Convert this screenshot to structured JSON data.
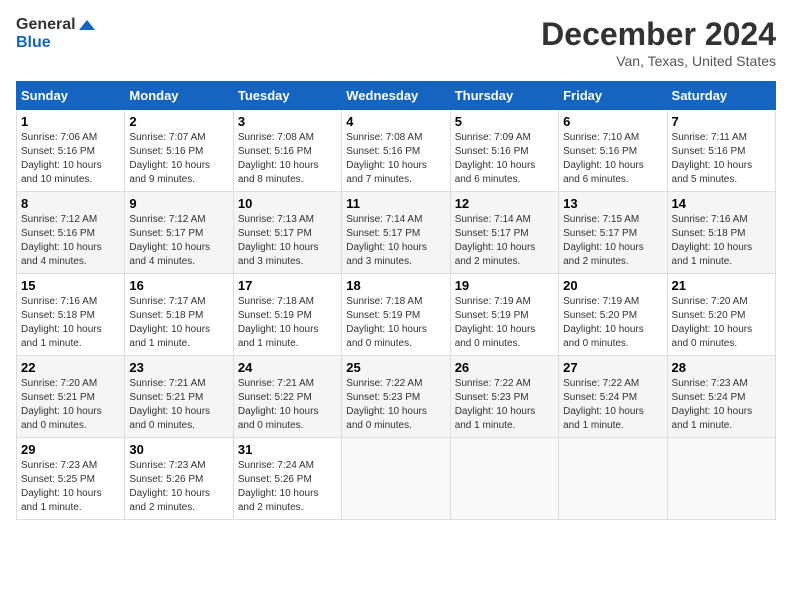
{
  "header": {
    "logo_line1": "General",
    "logo_line2": "Blue",
    "month_title": "December 2024",
    "location": "Van, Texas, United States"
  },
  "weekdays": [
    "Sunday",
    "Monday",
    "Tuesday",
    "Wednesday",
    "Thursday",
    "Friday",
    "Saturday"
  ],
  "weeks": [
    [
      {
        "day": "1",
        "sunrise": "7:06 AM",
        "sunset": "5:16 PM",
        "daylight": "10 hours and 10 minutes."
      },
      {
        "day": "2",
        "sunrise": "7:07 AM",
        "sunset": "5:16 PM",
        "daylight": "10 hours and 9 minutes."
      },
      {
        "day": "3",
        "sunrise": "7:08 AM",
        "sunset": "5:16 PM",
        "daylight": "10 hours and 8 minutes."
      },
      {
        "day": "4",
        "sunrise": "7:08 AM",
        "sunset": "5:16 PM",
        "daylight": "10 hours and 7 minutes."
      },
      {
        "day": "5",
        "sunrise": "7:09 AM",
        "sunset": "5:16 PM",
        "daylight": "10 hours and 6 minutes."
      },
      {
        "day": "6",
        "sunrise": "7:10 AM",
        "sunset": "5:16 PM",
        "daylight": "10 hours and 6 minutes."
      },
      {
        "day": "7",
        "sunrise": "7:11 AM",
        "sunset": "5:16 PM",
        "daylight": "10 hours and 5 minutes."
      }
    ],
    [
      {
        "day": "8",
        "sunrise": "7:12 AM",
        "sunset": "5:16 PM",
        "daylight": "10 hours and 4 minutes."
      },
      {
        "day": "9",
        "sunrise": "7:12 AM",
        "sunset": "5:17 PM",
        "daylight": "10 hours and 4 minutes."
      },
      {
        "day": "10",
        "sunrise": "7:13 AM",
        "sunset": "5:17 PM",
        "daylight": "10 hours and 3 minutes."
      },
      {
        "day": "11",
        "sunrise": "7:14 AM",
        "sunset": "5:17 PM",
        "daylight": "10 hours and 3 minutes."
      },
      {
        "day": "12",
        "sunrise": "7:14 AM",
        "sunset": "5:17 PM",
        "daylight": "10 hours and 2 minutes."
      },
      {
        "day": "13",
        "sunrise": "7:15 AM",
        "sunset": "5:17 PM",
        "daylight": "10 hours and 2 minutes."
      },
      {
        "day": "14",
        "sunrise": "7:16 AM",
        "sunset": "5:18 PM",
        "daylight": "10 hours and 1 minute."
      }
    ],
    [
      {
        "day": "15",
        "sunrise": "7:16 AM",
        "sunset": "5:18 PM",
        "daylight": "10 hours and 1 minute."
      },
      {
        "day": "16",
        "sunrise": "7:17 AM",
        "sunset": "5:18 PM",
        "daylight": "10 hours and 1 minute."
      },
      {
        "day": "17",
        "sunrise": "7:18 AM",
        "sunset": "5:19 PM",
        "daylight": "10 hours and 1 minute."
      },
      {
        "day": "18",
        "sunrise": "7:18 AM",
        "sunset": "5:19 PM",
        "daylight": "10 hours and 0 minutes."
      },
      {
        "day": "19",
        "sunrise": "7:19 AM",
        "sunset": "5:19 PM",
        "daylight": "10 hours and 0 minutes."
      },
      {
        "day": "20",
        "sunrise": "7:19 AM",
        "sunset": "5:20 PM",
        "daylight": "10 hours and 0 minutes."
      },
      {
        "day": "21",
        "sunrise": "7:20 AM",
        "sunset": "5:20 PM",
        "daylight": "10 hours and 0 minutes."
      }
    ],
    [
      {
        "day": "22",
        "sunrise": "7:20 AM",
        "sunset": "5:21 PM",
        "daylight": "10 hours and 0 minutes."
      },
      {
        "day": "23",
        "sunrise": "7:21 AM",
        "sunset": "5:21 PM",
        "daylight": "10 hours and 0 minutes."
      },
      {
        "day": "24",
        "sunrise": "7:21 AM",
        "sunset": "5:22 PM",
        "daylight": "10 hours and 0 minutes."
      },
      {
        "day": "25",
        "sunrise": "7:22 AM",
        "sunset": "5:23 PM",
        "daylight": "10 hours and 0 minutes."
      },
      {
        "day": "26",
        "sunrise": "7:22 AM",
        "sunset": "5:23 PM",
        "daylight": "10 hours and 1 minute."
      },
      {
        "day": "27",
        "sunrise": "7:22 AM",
        "sunset": "5:24 PM",
        "daylight": "10 hours and 1 minute."
      },
      {
        "day": "28",
        "sunrise": "7:23 AM",
        "sunset": "5:24 PM",
        "daylight": "10 hours and 1 minute."
      }
    ],
    [
      {
        "day": "29",
        "sunrise": "7:23 AM",
        "sunset": "5:25 PM",
        "daylight": "10 hours and 1 minute."
      },
      {
        "day": "30",
        "sunrise": "7:23 AM",
        "sunset": "5:26 PM",
        "daylight": "10 hours and 2 minutes."
      },
      {
        "day": "31",
        "sunrise": "7:24 AM",
        "sunset": "5:26 PM",
        "daylight": "10 hours and 2 minutes."
      },
      null,
      null,
      null,
      null
    ]
  ]
}
